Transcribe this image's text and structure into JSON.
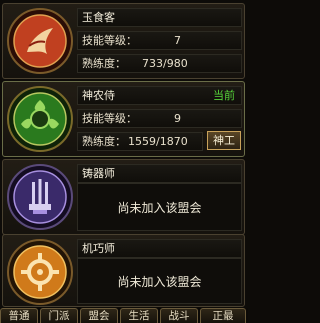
{
  "professions": [
    {
      "name": "玉食客",
      "skill_level_label": "技能等级：",
      "skill_level": "7",
      "proficiency_label": "熟练度：",
      "proficiency": "733/980"
    },
    {
      "name": "神农侍",
      "status": "当前",
      "skill_level_label": "技能等级：",
      "skill_level": "9",
      "proficiency_label": "熟练度：",
      "proficiency": "1559/1870",
      "button": "神工"
    },
    {
      "name": "铸器师",
      "not_joined": "尚未加入该盟会"
    },
    {
      "name": "机巧师",
      "not_joined": "尚未加入该盟会"
    }
  ],
  "tabs": [
    "普通",
    "门派",
    "盟会",
    "生活",
    "战斗",
    "正最"
  ],
  "colors": {
    "current_status": "#56d43a",
    "medal_food": "#c04020",
    "medal_herb": "#3e9a2a",
    "medal_forge": "#6a4ab0",
    "medal_mech": "#d07a1a"
  }
}
